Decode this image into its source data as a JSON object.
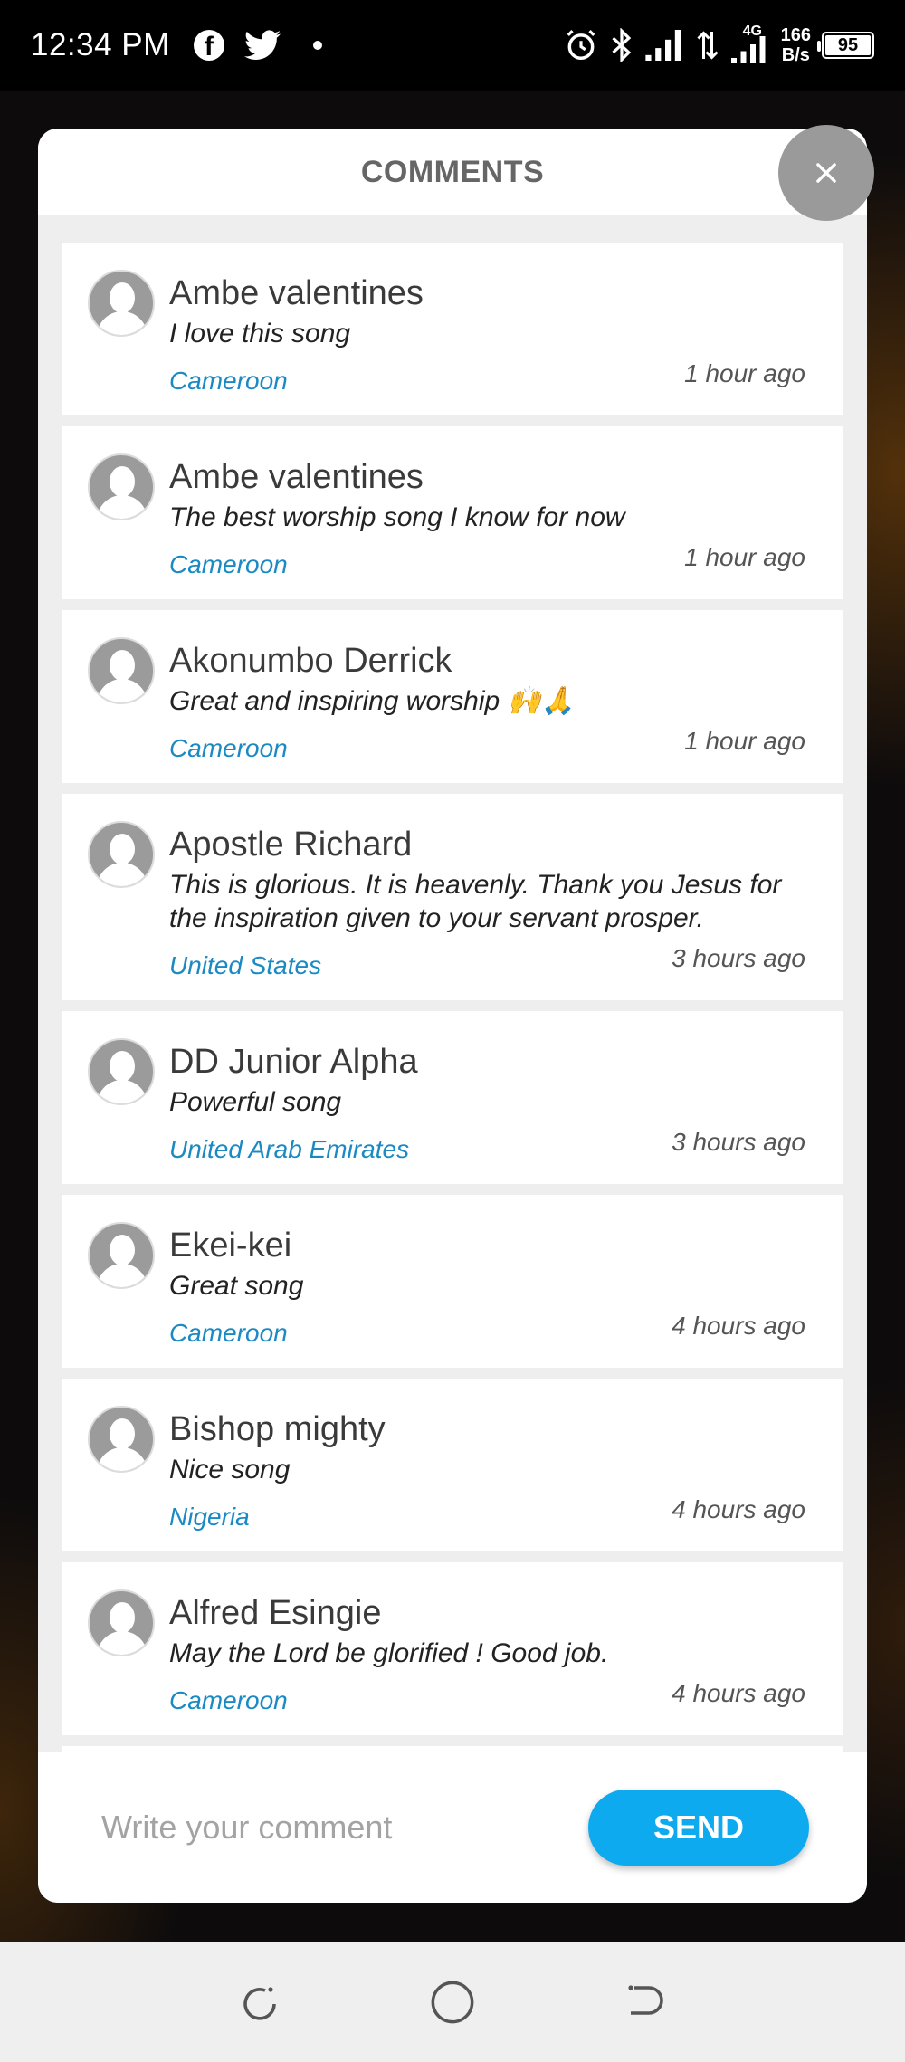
{
  "status_bar": {
    "time": "12:34 PM",
    "network_speed_value": "166",
    "network_speed_unit": "B/s",
    "network_type": "4G",
    "battery": "95",
    "icons": [
      "facebook-icon",
      "twitter-icon",
      "alarm-icon",
      "bluetooth-icon",
      "signal-icon",
      "data-transfer-icon",
      "battery-icon"
    ]
  },
  "modal": {
    "title": "COMMENTS",
    "close_icon": "close-icon"
  },
  "comments": [
    {
      "name": "Ambe valentines",
      "text": "I love this song",
      "country": "Cameroon",
      "time": "1 hour ago"
    },
    {
      "name": "Ambe valentines",
      "text": "The best worship song I know for now",
      "country": "Cameroon",
      "time": "1 hour ago"
    },
    {
      "name": "Akonumbo Derrick",
      "text": "Great and inspiring worship 🙌🙏",
      "country": "Cameroon",
      "time": "1 hour ago"
    },
    {
      "name": "Apostle Richard",
      "text": "This is glorious. It is heavenly. Thank you Jesus for the inspiration given to your servant prosper.",
      "country": "United States",
      "time": "3 hours ago"
    },
    {
      "name": "DD Junior Alpha",
      "text": "Powerful song",
      "country": "United Arab Emirates",
      "time": "3 hours ago"
    },
    {
      "name": "Ekei-kei",
      "text": "Great song",
      "country": "Cameroon",
      "time": "4 hours ago"
    },
    {
      "name": "Bishop mighty",
      "text": "Nice song",
      "country": "Nigeria",
      "time": "4 hours ago"
    },
    {
      "name": "Alfred Esingie",
      "text": "May the Lord be glorified ! Good job.",
      "country": "Cameroon",
      "time": "4 hours ago"
    }
  ],
  "compose": {
    "placeholder": "Write your comment",
    "value": "",
    "send_label": "SEND"
  },
  "nav_bar": {
    "icons": [
      "recent-apps-icon",
      "home-icon",
      "back-icon"
    ]
  },
  "colors": {
    "accent": "#0eaaef",
    "country_link": "#1b8ac2",
    "close_button": "#9a9a9a"
  }
}
